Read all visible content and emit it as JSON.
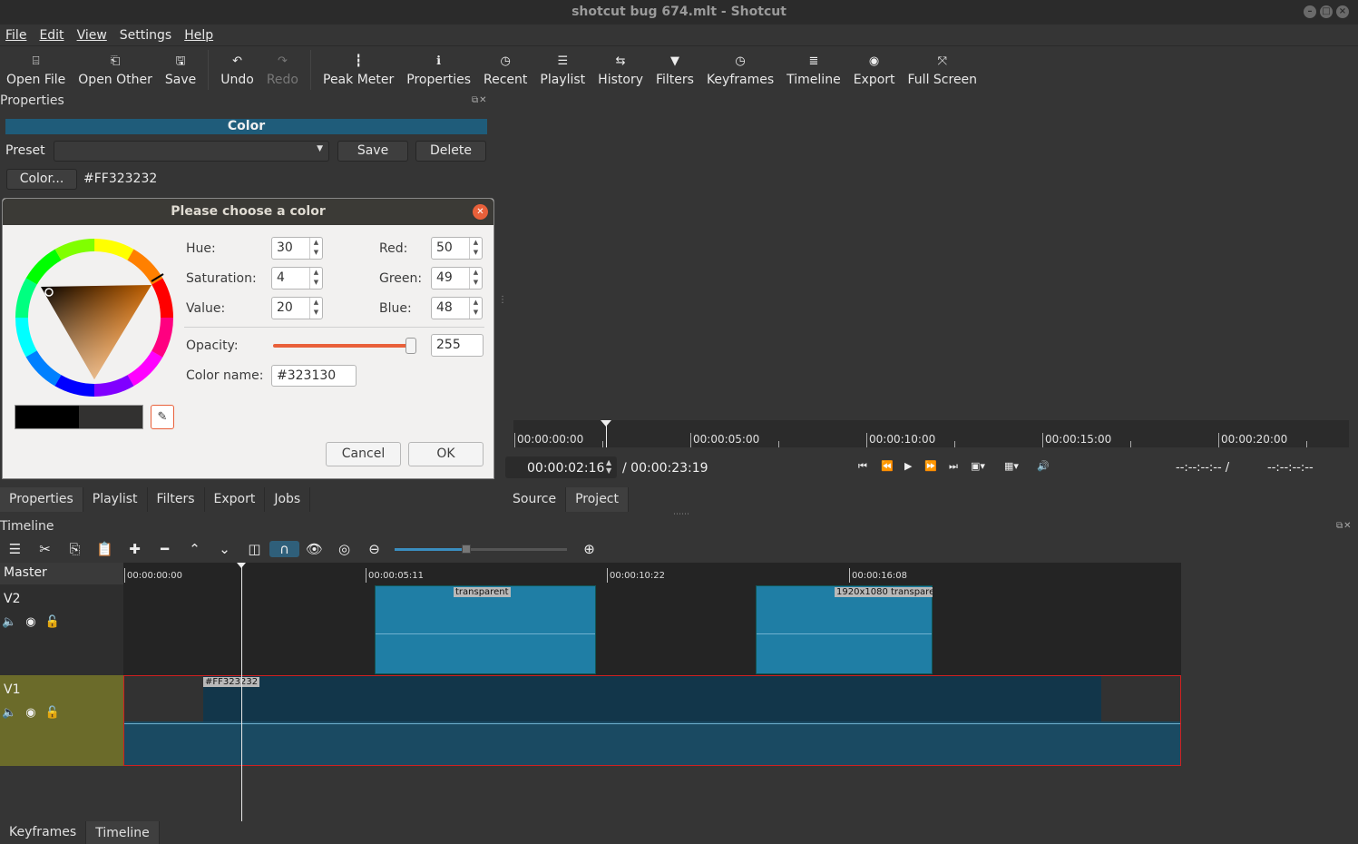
{
  "window": {
    "title": "shotcut bug 674.mlt - Shotcut"
  },
  "menu": [
    "File",
    "Edit",
    "View",
    "Settings",
    "Help"
  ],
  "toolbar": [
    {
      "label": "Open File",
      "icon": "⌸"
    },
    {
      "label": "Open Other",
      "icon": "⎗"
    },
    {
      "label": "Save",
      "icon": "🖫"
    },
    {
      "label": "Undo",
      "icon": "↶"
    },
    {
      "label": "Redo",
      "icon": "↷"
    },
    {
      "label": "Peak Meter",
      "icon": "┇"
    },
    {
      "label": "Properties",
      "icon": "ℹ"
    },
    {
      "label": "Recent",
      "icon": "◷"
    },
    {
      "label": "Playlist",
      "icon": "☰"
    },
    {
      "label": "History",
      "icon": "⇆"
    },
    {
      "label": "Filters",
      "icon": "▼"
    },
    {
      "label": "Keyframes",
      "icon": "◷"
    },
    {
      "label": "Timeline",
      "icon": "≣"
    },
    {
      "label": "Export",
      "icon": "◉"
    },
    {
      "label": "Full Screen",
      "icon": "⤧"
    }
  ],
  "properties": {
    "header": "Properties",
    "title": "Color",
    "preset_label": "Preset",
    "save": "Save",
    "delete": "Delete",
    "color_button": "Color...",
    "color_value": "#FF323232"
  },
  "dialog": {
    "title": "Please choose a color",
    "hue_label": "Hue:",
    "hue": "30",
    "saturation_label": "Saturation:",
    "saturation": "4",
    "value_label": "Value:",
    "value": "20",
    "red_label": "Red:",
    "red": "50",
    "green_label": "Green:",
    "green": "49",
    "blue_label": "Blue:",
    "blue": "48",
    "opacity_label": "Opacity:",
    "opacity": "255",
    "colorname_label": "Color name:",
    "colorname": "#323130",
    "cancel": "Cancel",
    "ok": "OK"
  },
  "left_tabs": [
    "Properties",
    "Playlist",
    "Filters",
    "Export",
    "Jobs"
  ],
  "player": {
    "ruler": [
      "00:00:00:00",
      "00:00:05:00",
      "00:00:10:00",
      "00:00:15:00",
      "00:00:20:00"
    ],
    "position": "00:00:02:16",
    "duration": "/ 00:00:23:19",
    "in_point": "--:--:--:-- /",
    "out_point": "--:--:--:--",
    "tabs": [
      "Source",
      "Project"
    ]
  },
  "timeline": {
    "header": "Timeline",
    "ruler": [
      "00:00:00:00",
      "00:00:05:11",
      "00:00:10:22",
      "00:00:16:08"
    ],
    "tracks": [
      {
        "name": "Master"
      },
      {
        "name": "V2",
        "clips": [
          "transparent",
          "1920x1080 transpare"
        ]
      },
      {
        "name": "V1",
        "clips": [
          "#FF323232"
        ]
      }
    ]
  },
  "bottom_tabs": [
    "Keyframes",
    "Timeline"
  ],
  "colors": {
    "accent": "#1f5c7a",
    "clip": "#1f7ea5",
    "v1_head": "#6b6b2a",
    "close": "#e9603a"
  }
}
